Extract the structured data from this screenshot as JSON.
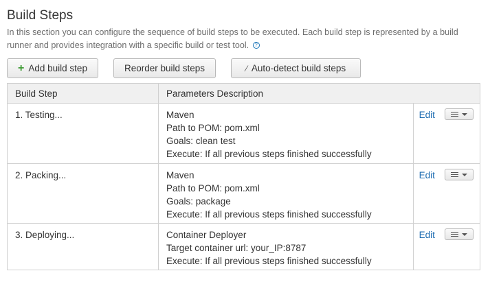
{
  "header": {
    "title": "Build Steps",
    "description": "In this section you can configure the sequence of build steps to be executed. Each build step is represented by a build runner and provides integration with a specific build or test tool.",
    "help_symbol": "?"
  },
  "toolbar": {
    "add_label": "Add build step",
    "add_icon": "plus-icon",
    "reorder_label": "Reorder build steps",
    "autodetect_label": "Auto-detect build steps",
    "autodetect_icon": "magic-wand-icon"
  },
  "table": {
    "col_step": "Build Step",
    "col_params": "Parameters Description",
    "rows": [
      {
        "step": "1. Testing...",
        "lines": [
          "Maven",
          "Path to POM: pom.xml",
          "Goals: clean test",
          "Execute: If all previous steps finished successfully"
        ],
        "edit_label": "Edit"
      },
      {
        "step": "2. Packing...",
        "lines": [
          "Maven",
          "Path to POM: pom.xml",
          "Goals: package",
          "Execute: If all previous steps finished successfully"
        ],
        "edit_label": "Edit"
      },
      {
        "step": "3. Deploying...",
        "lines": [
          "Container Deployer",
          "Target container url: your_IP:8787",
          "Execute: If all previous steps finished successfully"
        ],
        "edit_label": "Edit"
      }
    ]
  },
  "colors": {
    "link": "#1a6ab0",
    "add_icon": "#3f9c35",
    "header_bg": "#f0f0f0"
  }
}
